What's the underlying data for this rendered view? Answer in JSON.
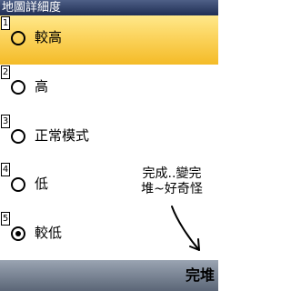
{
  "title": "地圖詳細度",
  "options": [
    {
      "number": "1",
      "label": "較高",
      "selected": false,
      "highlighted": true
    },
    {
      "number": "2",
      "label": "高",
      "selected": false,
      "highlighted": false
    },
    {
      "number": "3",
      "label": "正常模式",
      "selected": false,
      "highlighted": false
    },
    {
      "number": "4",
      "label": "低",
      "selected": false,
      "highlighted": false
    },
    {
      "number": "5",
      "label": "較低",
      "selected": true,
      "highlighted": false
    }
  ],
  "annotation": {
    "line1": "完成..變完",
    "line2": "堆~好奇怪"
  },
  "softkey": {
    "right_label": "完堆"
  },
  "colors": {
    "title_bar": "#2d3b62",
    "highlight": "#f9c940",
    "softkey_bar": "#7c8696"
  }
}
